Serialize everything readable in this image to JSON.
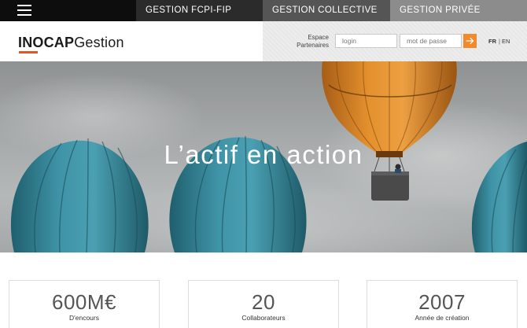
{
  "topbar": {
    "menu_icon": "hamburger-menu-icon",
    "tabs": [
      {
        "label": "GESTION FCPI-FIP"
      },
      {
        "label": "GESTION COLLECTIVE"
      },
      {
        "label": "GESTION PRIVÉE"
      }
    ]
  },
  "header": {
    "logo_bold": "INOCAP",
    "logo_regular": "Gestion",
    "partner_label_line1": "Espace",
    "partner_label_line2": "Partenaires",
    "login_placeholder": "login",
    "password_placeholder": "mot de passe",
    "submit_icon": "arrow-right-icon",
    "lang_fr": "FR",
    "lang_sep": "|",
    "lang_en": "EN"
  },
  "hero": {
    "title": "L’actif en action"
  },
  "stats": [
    {
      "value": "600M€",
      "label": "D'encours"
    },
    {
      "value": "20",
      "label": "Collaborateurs"
    },
    {
      "value": "2007",
      "label": "Année de création"
    }
  ],
  "colors": {
    "accent_orange": "#f08a2c",
    "logo_orange": "#e8531f",
    "balloon_teal": "#3e8ea0",
    "balloon_orange": "#e08a2a"
  }
}
